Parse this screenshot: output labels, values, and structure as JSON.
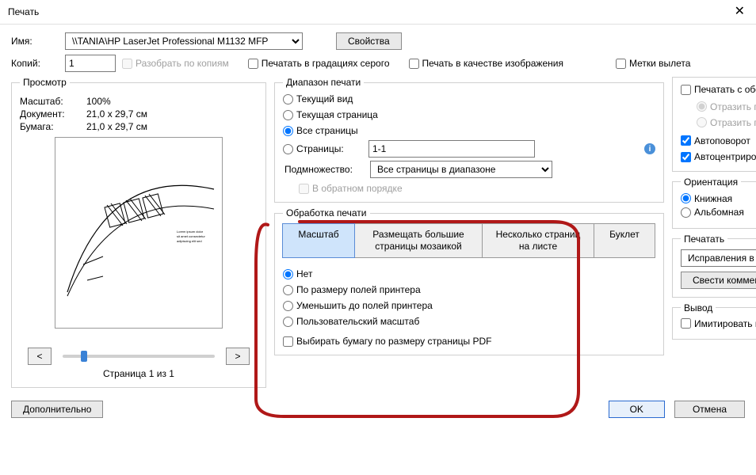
{
  "title": "Печать",
  "name_label": "Имя:",
  "printer": "\\\\TANIA\\HP LaserJet Professional M1132 MFP",
  "properties_btn": "Свойства",
  "copies_label": "Копий:",
  "copies_value": "1",
  "collate": "Разобрать по копиям",
  "grayscale": "Печатать в градациях серого",
  "as_image": "Печать в качестве изображения",
  "bleed_marks": "Метки вылета",
  "preview": {
    "legend": "Просмотр",
    "scale_lbl": "Масштаб:",
    "scale_val": "100%",
    "doc_lbl": "Документ:",
    "doc_val": "21,0 x 29,7 см",
    "paper_lbl": "Бумага:",
    "paper_val": "21,0 x 29,7 см",
    "pageinfo": "Страница 1 из 1",
    "prev": "<",
    "next": ">"
  },
  "range": {
    "legend": "Диапазон печати",
    "current_view": "Текущий вид",
    "current_page": "Текущая страница",
    "all_pages": "Все страницы",
    "pages": "Страницы:",
    "pages_value": "1-1",
    "subset_lbl": "Подмножество:",
    "subset_value": "Все страницы в диапазоне",
    "reverse": "В обратном порядке"
  },
  "handling": {
    "legend": "Обработка печати",
    "tab_scale": "Масштаб",
    "tab_tile": "Размещать большие страницы мозаикой",
    "tab_nup": "Несколько страниц на листе",
    "tab_booklet": "Буклет",
    "r_none": "Нет",
    "r_fit": "По размеру полей принтера",
    "r_shrink": "Уменьшить до полей принтера",
    "r_custom": "Пользовательский масштаб",
    "choose_paper": "Выбирать бумагу по размеру страницы PDF"
  },
  "duplex": {
    "both_sides": "Печатать с обеих сторон бумаги",
    "long_edge": "Отразить по длинному краю",
    "short_edge": "Отразить по короткому краю",
    "autorotate": "Автоповорот",
    "autocenter": "Автоцентрирование"
  },
  "orientation": {
    "legend": "Ориентация",
    "portrait": "Книжная",
    "landscape": "Альбомная"
  },
  "output": {
    "legend": "Печатать",
    "what": "Исправления в документе",
    "flatten": "Свести комментарии"
  },
  "out2": {
    "legend": "Вывод",
    "overprint": "Имитировать печать поверх"
  },
  "advanced_btn": "Дополнительно",
  "ok_btn": "OK",
  "cancel_btn": "Отмена"
}
